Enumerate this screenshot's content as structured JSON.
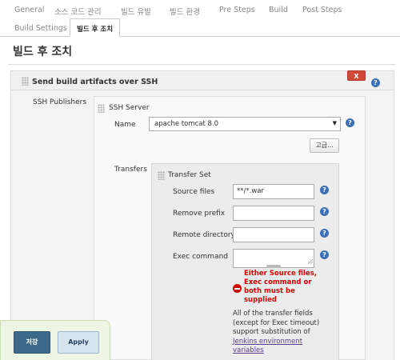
{
  "tabs": [
    {
      "label": "General"
    },
    {
      "label": "소스 코드 관리"
    },
    {
      "label": "빌드 유발"
    },
    {
      "label": "빌드 환경"
    },
    {
      "label": "Pre Steps"
    },
    {
      "label": "Build"
    },
    {
      "label": "Post Steps"
    },
    {
      "label": "Build Settings"
    },
    {
      "label": "빌드 후 조치"
    }
  ],
  "section_title": "빌드 후 조치",
  "plugin_block": {
    "title": "Send build artifacts over SSH",
    "delete_label": "X",
    "publishers_label": "SSH Publishers",
    "server": {
      "title": "SSH Server",
      "name_label": "Name",
      "name_value": "apache tomcat 8.0",
      "advanced_label": "고급...",
      "transfers_label": "Transfers",
      "transfer_set": {
        "title": "Transfer Set",
        "source_files_label": "Source files",
        "source_files_value": "**/*.war",
        "remove_prefix_label": "Remove prefix",
        "remove_prefix_value": "",
        "remote_directory_label": "Remote directory",
        "remote_directory_value": "",
        "exec_command_label": "Exec command",
        "exec_command_value": "",
        "error_text": "Either Source files, Exec command or both must be supplied",
        "note_text": "All of the transfer fields (except for Exec timeout) support substitution of",
        "note_link": "Jenkins environment variables"
      }
    }
  },
  "help_glyph": "?",
  "buttons": {
    "save": "저장",
    "apply": "Apply"
  },
  "colors": {
    "delete": "#d24939",
    "help": "#3b6fb6",
    "error": "#cc0000",
    "save": "#3d6a8a",
    "apply": "#d6e4f2"
  }
}
